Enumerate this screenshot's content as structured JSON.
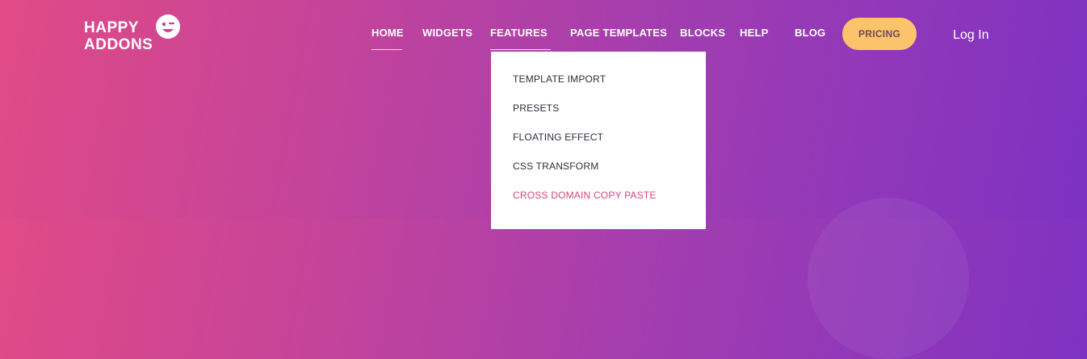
{
  "logo": {
    "line1": "HAPPY",
    "line2": "ADDONS"
  },
  "nav": {
    "items": [
      {
        "label": "HOME"
      },
      {
        "label": "WIDGETS"
      },
      {
        "label": "FEATURES"
      },
      {
        "label": "PAGE TEMPLATES"
      },
      {
        "label": "BLOCKS"
      },
      {
        "label": "HELP"
      },
      {
        "label": "BLOG"
      }
    ],
    "pricing_label": "PRICING",
    "login_label": "Log In"
  },
  "features_dropdown": {
    "items": [
      {
        "label": "TEMPLATE IMPORT"
      },
      {
        "label": "PRESETS"
      },
      {
        "label": "FLOATING EFFECT"
      },
      {
        "label": "CSS TRANSFORM"
      },
      {
        "label": "CROSS DOMAIN COPY PASTE"
      }
    ]
  },
  "colors": {
    "gradient_start": "#e14a86",
    "gradient_end": "#7d32c2",
    "pricing_bg": "#fcc36d",
    "dropdown_active": "#d7457e"
  }
}
